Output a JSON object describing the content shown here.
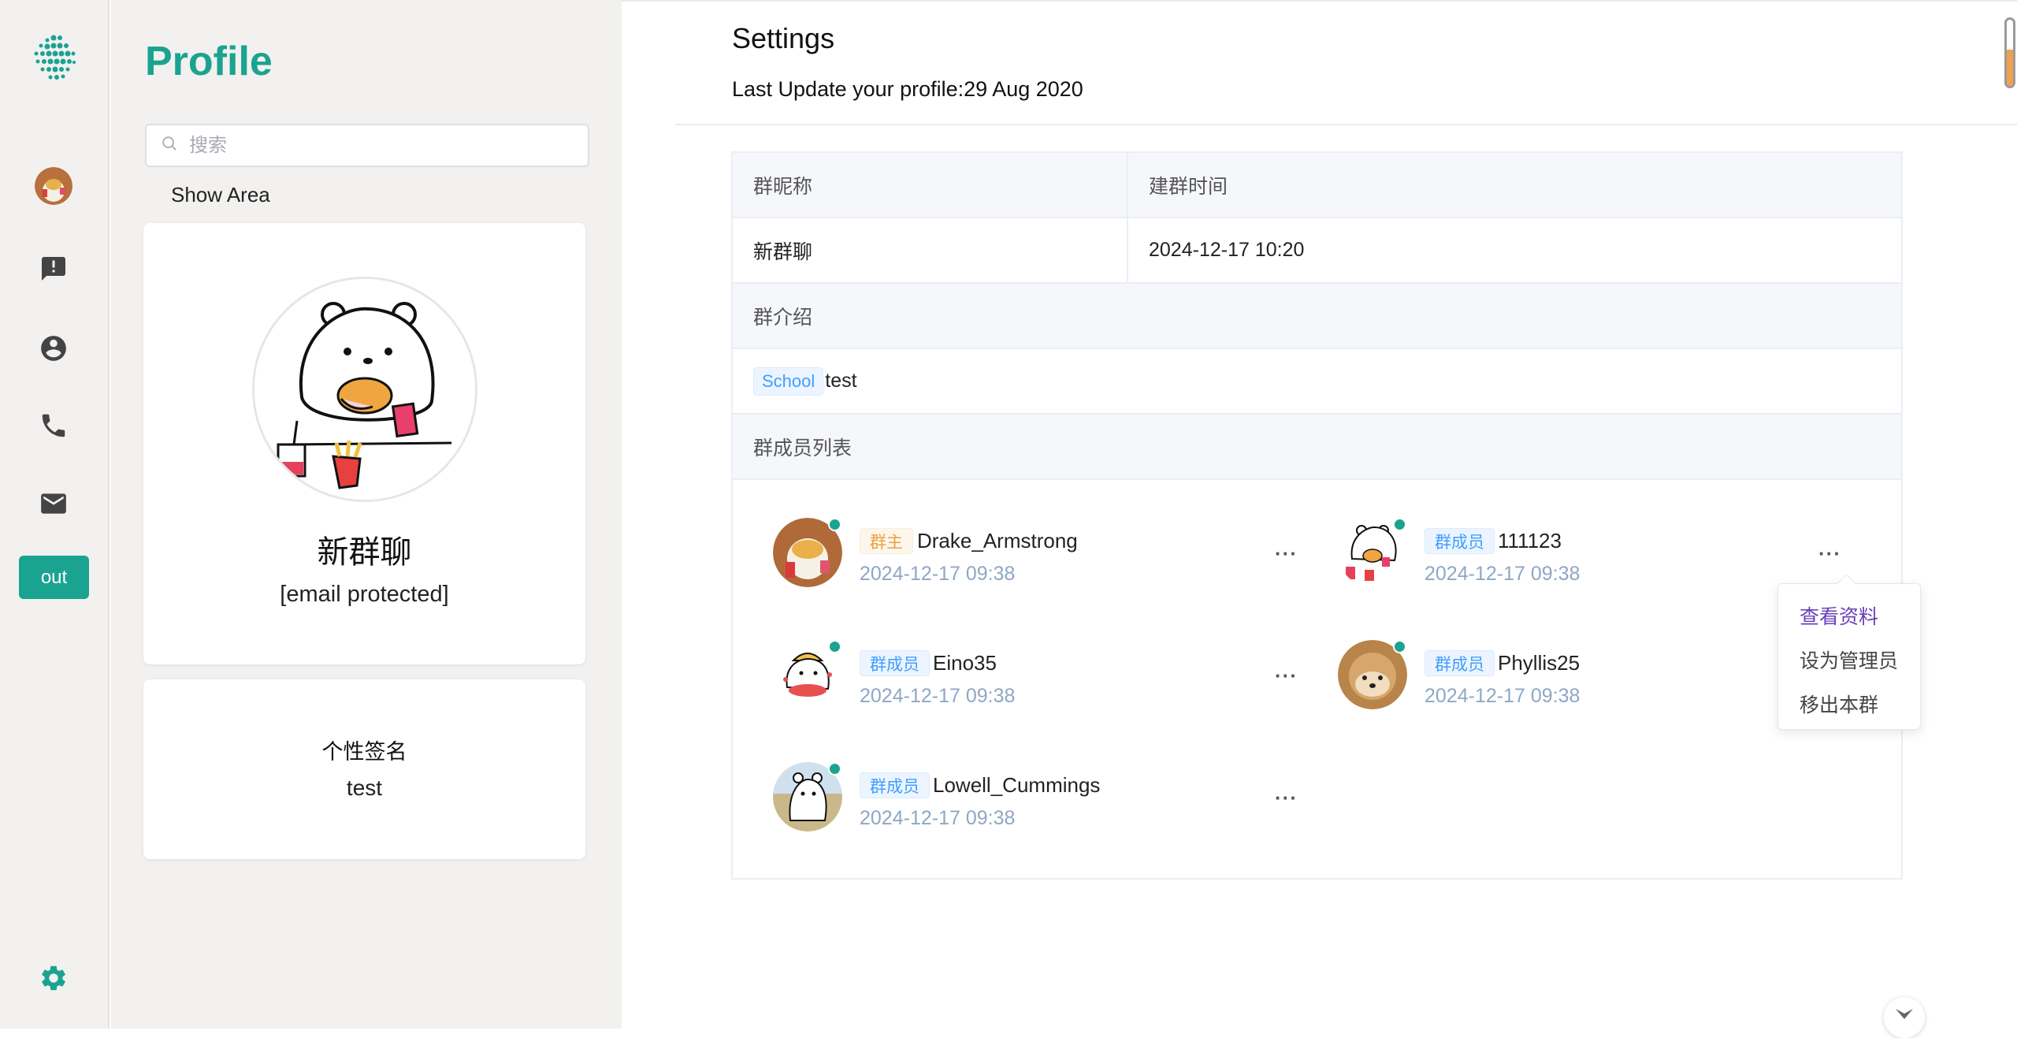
{
  "rail": {
    "out_label": "out",
    "icons": [
      "dots-logo-icon",
      "message-alert-icon",
      "account-circle-icon",
      "phone-icon",
      "mail-icon",
      "gear-icon"
    ]
  },
  "profile": {
    "title": "Profile",
    "search_placeholder": "搜索",
    "show_area_label": "Show Area",
    "group_name": "新群聊",
    "group_email": "[email protected]",
    "signature_label": "个性签名",
    "signature_value": "test"
  },
  "settings": {
    "title": "Settings",
    "last_update": "Last Update your profile:29 Aug 2020",
    "table": {
      "col_nickname": "群昵称",
      "col_created": "建群时间",
      "nickname_value": "新群聊",
      "created_value": "2024-12-17 10:20",
      "intro_label": "群介绍",
      "intro_tag": "School",
      "intro_value": "test",
      "members_label": "群成员列表"
    },
    "members": [
      {
        "role": "群主",
        "name": "Drake_Armstrong",
        "time": "2024-12-17 09:38"
      },
      {
        "role": "群成员",
        "name": "111123",
        "time": "2024-12-17 09:38"
      },
      {
        "role": "群成员",
        "name": "Eino35",
        "time": "2024-12-17 09:38"
      },
      {
        "role": "群成员",
        "name": "Phyllis25",
        "time": "2024-12-17 09:38"
      },
      {
        "role": "群成员",
        "name": "Lowell_Cummings",
        "time": "2024-12-17 09:38"
      }
    ],
    "more_label": "···",
    "dropdown": {
      "view_profile": "查看资料",
      "set_admin": "设为管理员",
      "remove": "移出本群"
    }
  },
  "colors": {
    "brand": "#1aa390",
    "owner_tag": "#e6a23c",
    "member_tag": "#409eff",
    "time_text": "#8fa7c4"
  }
}
